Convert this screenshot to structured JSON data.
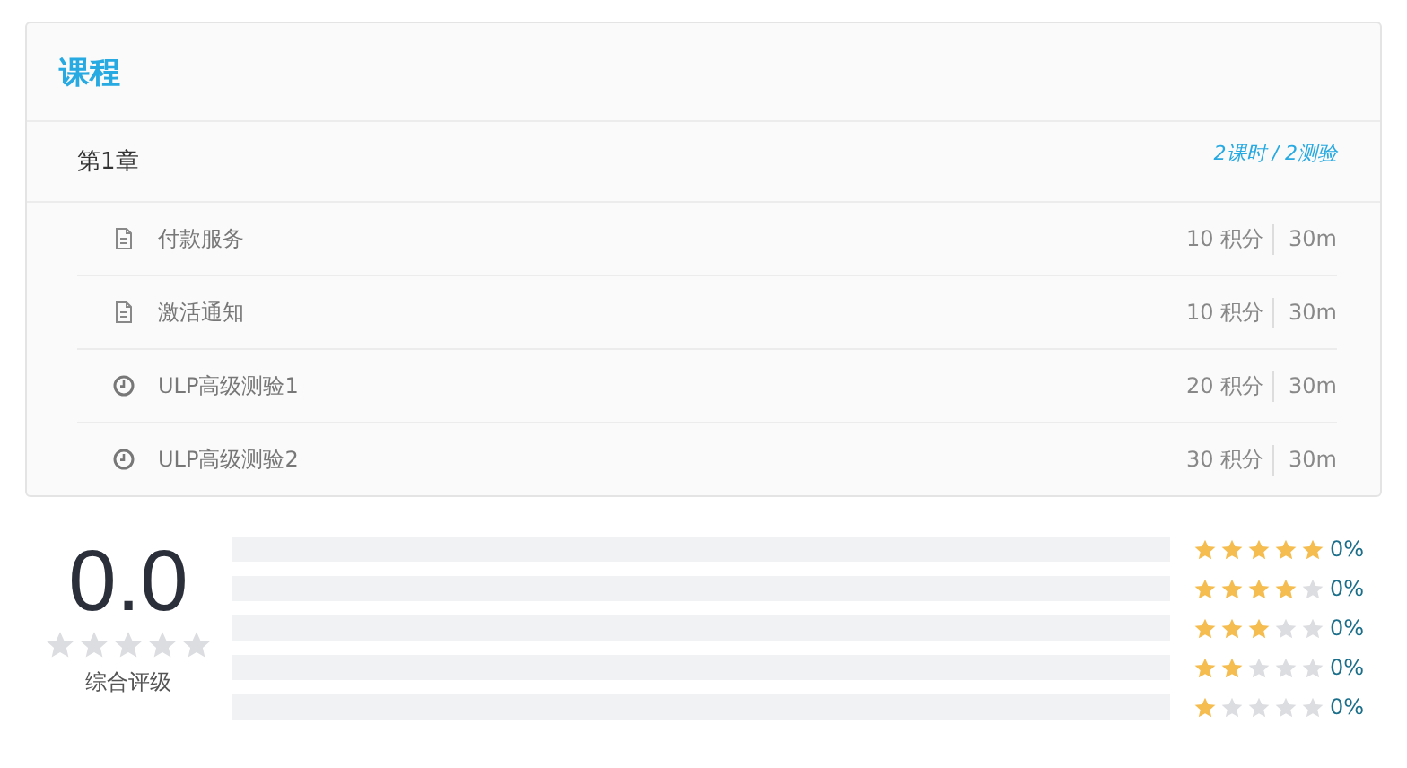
{
  "course": {
    "title": "课程",
    "chapters": [
      {
        "title": "第1章",
        "summary": "2课时 / 2测验",
        "lessons": [
          {
            "kind": "document",
            "title": "付款服务",
            "points": "10 积分",
            "duration": "30m"
          },
          {
            "kind": "document",
            "title": "激活通知",
            "points": "10 积分",
            "duration": "30m"
          },
          {
            "kind": "quiz",
            "title": "ULP高级测验1",
            "points": "20 积分",
            "duration": "30m"
          },
          {
            "kind": "quiz",
            "title": "ULP高级测验2",
            "points": "30 积分",
            "duration": "30m"
          }
        ]
      }
    ]
  },
  "rating": {
    "score": "0.0",
    "stars": 0,
    "label": "综合评级",
    "breakdown": [
      {
        "stars": 5,
        "percent": "0%"
      },
      {
        "stars": 4,
        "percent": "0%"
      },
      {
        "stars": 3,
        "percent": "0%"
      },
      {
        "stars": 2,
        "percent": "0%"
      },
      {
        "stars": 1,
        "percent": "0%"
      }
    ]
  }
}
